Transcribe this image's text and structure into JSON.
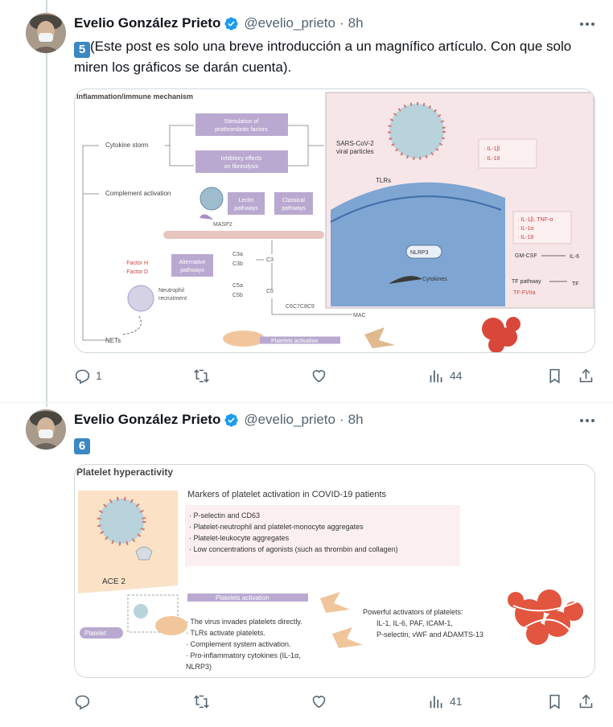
{
  "posts": [
    {
      "author": "Evelio González Prieto",
      "handle": "@evelio_prieto",
      "time": "8h",
      "number_emoji": "5",
      "text": "(Este post es solo una breve introducción a un magnífico artículo. Con que solo miren los gráficos se darán cuenta).",
      "figure": {
        "title": "Inflammation/immune mechanism",
        "labels": {
          "cytokine_storm": "Cytokine storm",
          "stim": "Stimulation of prothrombotic factors",
          "inhib": "Inhibitory effects on fibrinolysis",
          "complement": "Complement activation",
          "lectin": "Lectin pathways",
          "classical": "Classical pathways",
          "masp2": "MASP2",
          "alt": "Alternative pathways",
          "factor_h": "· Factor H",
          "factor_d": "· Factor D",
          "c3a": "C3a",
          "c3b": "C3b",
          "c3": "C3",
          "c5a": "C5a",
          "c5b": "C5b",
          "c5": "C5",
          "neutrophil": "Neutrophil recruitment",
          "c6": "C6C7C8C9",
          "mac": "MAC",
          "nets": "NETs",
          "plt": "Platelets activation",
          "sars": "SARS-CoV-2 viral particles",
          "tlrs": "TLRs",
          "il1b_top": "· IL-1β",
          "il18_top": "· IL-18",
          "nlrp3": "NLRP3",
          "cytokines": "Cytokines",
          "il1b_tnf": "· IL-1β, TNF-α",
          "il1a": "· IL-1α",
          "il18": "· IL-18",
          "gmcsf": "GM-CSF",
          "il6": "IL-6",
          "tf_pathway": "TF pathway",
          "tf": "TF",
          "tf_fviia": "TF-FVIIa"
        }
      },
      "stats": {
        "replies": "1",
        "retweets": "",
        "likes": "",
        "views": "44"
      }
    },
    {
      "author": "Evelio González Prieto",
      "handle": "@evelio_prieto",
      "time": "8h",
      "number_emoji": "6",
      "text": "",
      "figure": {
        "title": "Platelet hyperactivity",
        "markers_title": "Markers of platelet activation in COVID-19 patients",
        "markers": [
          "· P-selectin and CD63",
          "· Platelet-neutrophil and platelet-monocyte aggregates",
          "· Platelet-leukocyte aggregates",
          "· Low concentrations of agonists (such as thrombin and collagen)"
        ],
        "ace2": "ACE 2",
        "plt_activation": "Platelets activation",
        "platelet": "Platelet",
        "mechanisms": [
          "· The virus invades platelets directly.",
          "· TLRs activate platelets.",
          "· Complement system activation.",
          "· Pro-inflammatory cytokines (IL-1α,",
          "  NLRP3)"
        ],
        "activators_title": "Powerful activators of platelets:",
        "activators_l1": "IL-1, IL-6, PAF, ICAM-1,",
        "activators_l2": "P-selectin, vWF and ADAMTS-13"
      },
      "stats": {
        "replies": "",
        "retweets": "",
        "likes": "",
        "views": "41"
      }
    }
  ],
  "colors": {
    "verified": "#1d9bf0",
    "secondary_text": "#536471",
    "number_emoji_bg": "#3b88c3",
    "purple_box": "#b9a9d0",
    "thread_line": "#cfd9de"
  },
  "icons": [
    "avatar",
    "verified-badge-icon",
    "more-options-icon",
    "reply-icon",
    "retweet-icon",
    "like-icon",
    "views-icon",
    "bookmark-icon",
    "share-icon"
  ]
}
